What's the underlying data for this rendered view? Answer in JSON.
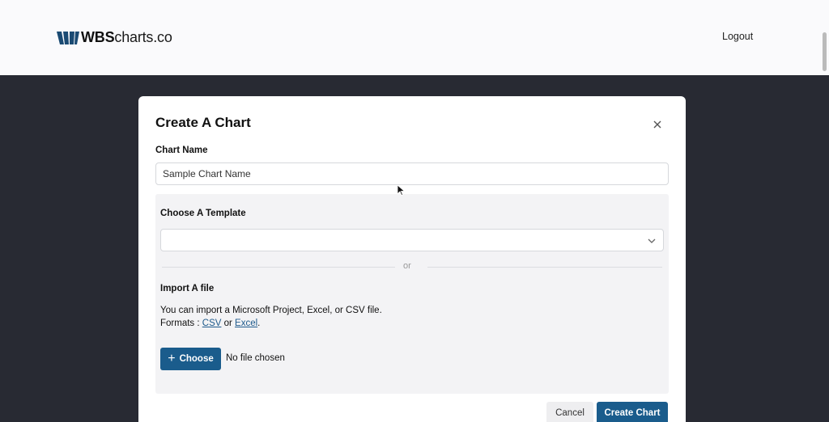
{
  "header": {
    "logo_bold": "WBS",
    "logo_rest": "charts.co",
    "logout_label": "Logout"
  },
  "modal": {
    "title": "Create A Chart",
    "chart_name_label": "Chart Name",
    "chart_name_value": "Sample Chart Name",
    "template_label": "Choose A Template",
    "template_value": "",
    "divider_text": "or",
    "import_label": "Import A file",
    "import_desc": "You can import a Microsoft Project, Excel, or CSV file.",
    "formats_prefix": "Formats : ",
    "format_csv": "CSV",
    "formats_or": " or ",
    "format_excel": "Excel",
    "formats_suffix": ".",
    "choose_label": "Choose",
    "no_file_text": "No file chosen",
    "cancel_label": "Cancel",
    "create_label": "Create Chart"
  },
  "icons": {
    "close": "close-icon",
    "chevron": "chevron-down-icon",
    "plus": "plus-icon",
    "logo": "wbs-logo-icon"
  },
  "colors": {
    "primary": "#1a5c8c",
    "backdrop": "#282a33",
    "header_bg": "#fafafc",
    "panel_bg": "#f3f3f5"
  }
}
